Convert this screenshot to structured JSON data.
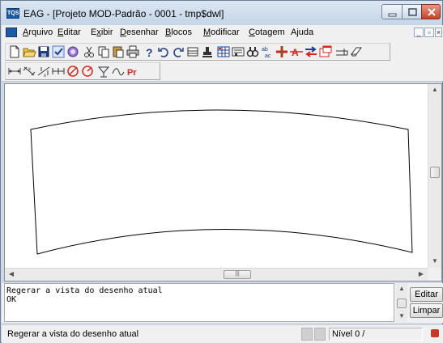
{
  "window": {
    "title": "EAG - [Projeto MOD-Padrão - 0001 - tmp$dwl]",
    "app_icon_text": "TQS"
  },
  "menu": {
    "items": [
      {
        "label": "Arquivo",
        "accel_index": 0
      },
      {
        "label": "Editar",
        "accel_index": 0
      },
      {
        "label": "Exibir",
        "accel_index": 1
      },
      {
        "label": "Desenhar",
        "accel_index": 0
      },
      {
        "label": "Blocos",
        "accel_index": 0
      },
      {
        "label": "Modificar",
        "accel_index": 0
      },
      {
        "label": "Cotagem",
        "accel_index": 0
      },
      {
        "label": "Ajuda",
        "accel_index": -1
      }
    ],
    "mdi_buttons": [
      "_",
      "×"
    ]
  },
  "toolbar1": {
    "icons": [
      "new-file-icon",
      "open-folder-icon",
      "save-icon",
      "check-icon",
      "plot-icon",
      "cut-icon",
      "copy-icon",
      "paste-icon",
      "print-icon",
      "help-icon",
      "undo-icon",
      "redo-icon",
      "layers-icon",
      "stamp-icon",
      "grid-icon",
      "binoculars-icon",
      "find-icon",
      "replace-text-icon",
      "add-red-icon",
      "text-red-icon",
      "swap-icon",
      "window-icon",
      "block-icon",
      "eraser-icon"
    ]
  },
  "toolbar2": {
    "icons": [
      "dim-linear-icon",
      "dim-aligned-icon",
      "dim-angular-icon",
      "dim-continuous-icon",
      "dim-circle-icon",
      "dim-arc-icon",
      "dim-level-icon",
      "dim-curve-icon",
      "pr-icon"
    ],
    "pr_label": "Pr"
  },
  "command": {
    "lines": [
      "Regerar a vista do desenho atual",
      "OK"
    ],
    "edit_label": "Editar",
    "clear_label": "Limpar"
  },
  "status": {
    "message": "Regerar a vista do desenho atual",
    "level": "Nível 0 /"
  },
  "colors": {
    "titlebar": "#c5d5e8",
    "close_button": "#c2442a",
    "accent_red": "#d9261c",
    "accent_blue": "#1d5aa6"
  }
}
